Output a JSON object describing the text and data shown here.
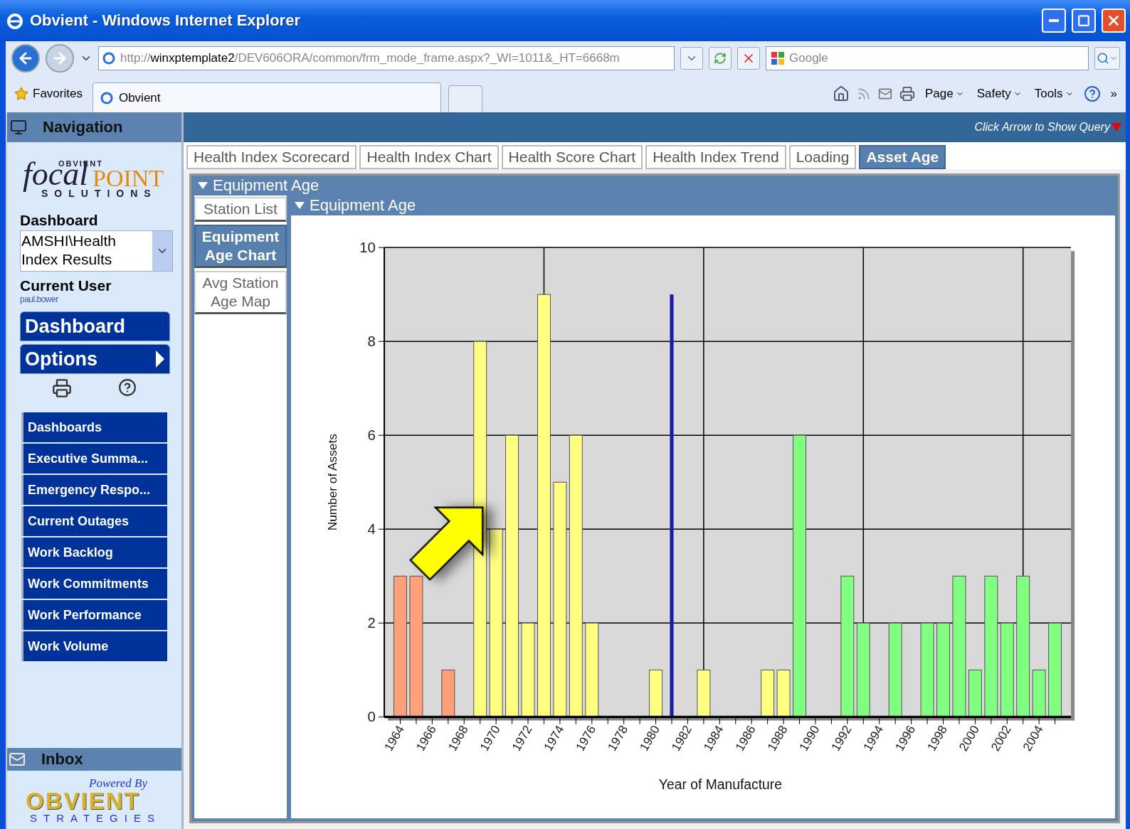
{
  "browser": {
    "title": "Obvient - Windows Internet Explorer",
    "address": {
      "scheme": "http://",
      "host": "winxptemplate2",
      "path": "/DEV606ORA/common/frm_mode_frame.aspx?_WI=1011&_HT=6668m"
    },
    "search": {
      "placeholder": "Google"
    },
    "favorites": "Favorites",
    "tabs": [
      {
        "label": "Obvient",
        "selected": true
      }
    ],
    "menus": [
      "Page",
      "Safety",
      "Tools"
    ],
    "more": "»"
  },
  "sidebar": {
    "title": "Navigation",
    "logo": {
      "top": "OBVIENT",
      "script": "focal",
      "word": "POINT",
      "sub": "SOLUTIONS"
    },
    "dashboard_label": "Dashboard",
    "dashboard_value": "AMSHI\\Health Index Results",
    "user_label": "Current User",
    "user": "paul.bower",
    "buttons": [
      {
        "label": "Dashboard",
        "kind": "plain"
      },
      {
        "label": "Options",
        "kind": "submenu"
      }
    ],
    "items": [
      "Dashboards",
      "Executive Summa...",
      "Emergency Respo...",
      "Current Outages",
      "Work Backlog",
      "Work Commitments",
      "Work Performance",
      "Work Volume"
    ],
    "inbox": "Inbox",
    "powered": {
      "tagline": "Powered By",
      "name": "OBVIENT",
      "sub": "STRATEGIES"
    }
  },
  "main": {
    "query_hint": "Click Arrow to Show Query",
    "tabs": [
      {
        "label": "Health Index Scorecard",
        "selected": false
      },
      {
        "label": "Health Index Chart",
        "selected": false
      },
      {
        "label": "Health Score Chart",
        "selected": false
      },
      {
        "label": "Health Index Trend",
        "selected": false
      },
      {
        "label": "Loading",
        "selected": false
      },
      {
        "label": "Asset Age",
        "selected": true
      }
    ],
    "panel_title": "Equipment Age",
    "subtabs": [
      {
        "label": "Station List",
        "selected": false
      },
      {
        "label": "Equipment Age Chart",
        "selected": true
      },
      {
        "label": "Avg Station Age Map",
        "selected": false
      }
    ],
    "chart_title": "Equipment Age",
    "chart_data": {
      "type": "bar",
      "stacked": true,
      "grid": true,
      "xlabel": "Year of Manufacture",
      "ylabel": "Number of Assets",
      "xlim": [
        1963,
        2006
      ],
      "ylim": [
        0,
        10
      ],
      "yticks": [
        0,
        2,
        4,
        6,
        8,
        10
      ],
      "xticks": [
        1964,
        1966,
        1968,
        1970,
        1972,
        1974,
        1976,
        1978,
        1980,
        1982,
        1984,
        1986,
        1988,
        1990,
        1992,
        1994,
        1996,
        1998,
        2000,
        2002,
        2004
      ],
      "x": [
        1964,
        1965,
        1966,
        1967,
        1968,
        1969,
        1970,
        1971,
        1972,
        1973,
        1974,
        1975,
        1976,
        1977,
        1978,
        1979,
        1980,
        1981,
        1982,
        1983,
        1984,
        1985,
        1986,
        1987,
        1988,
        1989,
        1990,
        1991,
        1992,
        1993,
        1994,
        1995,
        1996,
        1997,
        1998,
        1999,
        2000,
        2001,
        2002,
        2003,
        2004,
        2005
      ],
      "series": [
        {
          "color": "#ffa07a",
          "values": [
            3,
            3,
            null,
            1,
            null,
            null,
            null,
            null,
            null,
            null,
            null,
            null,
            null,
            null,
            null,
            null,
            null,
            null,
            null,
            null,
            null,
            null,
            null,
            null,
            null,
            null,
            null,
            null,
            null,
            null,
            null,
            null,
            null,
            null,
            null,
            null,
            null,
            null,
            null,
            null,
            null,
            null
          ]
        },
        {
          "color": "#ffff80",
          "values": [
            null,
            null,
            null,
            null,
            null,
            8,
            4,
            6,
            2,
            9,
            5,
            6,
            2,
            null,
            null,
            null,
            1,
            null,
            null,
            1,
            null,
            null,
            null,
            1,
            1,
            null,
            null,
            null,
            null,
            null,
            null,
            null,
            null,
            null,
            null,
            null,
            null,
            null,
            null,
            null,
            null,
            null
          ]
        },
        {
          "color": "#1a1aa8",
          "values": [
            null,
            null,
            null,
            null,
            null,
            null,
            null,
            null,
            null,
            null,
            null,
            null,
            null,
            null,
            null,
            null,
            null,
            9,
            null,
            null,
            null,
            null,
            null,
            null,
            null,
            null,
            null,
            null,
            null,
            null,
            null,
            null,
            null,
            null,
            null,
            null,
            null,
            null,
            null,
            null,
            null,
            null
          ]
        },
        {
          "color": "#80ff80",
          "values": [
            null,
            null,
            null,
            null,
            null,
            null,
            null,
            null,
            null,
            null,
            null,
            null,
            null,
            null,
            null,
            null,
            null,
            null,
            null,
            null,
            null,
            null,
            null,
            null,
            null,
            6,
            null,
            null,
            3,
            2,
            null,
            2,
            null,
            2,
            2,
            3,
            1,
            3,
            2,
            3,
            1,
            2
          ]
        }
      ]
    }
  }
}
